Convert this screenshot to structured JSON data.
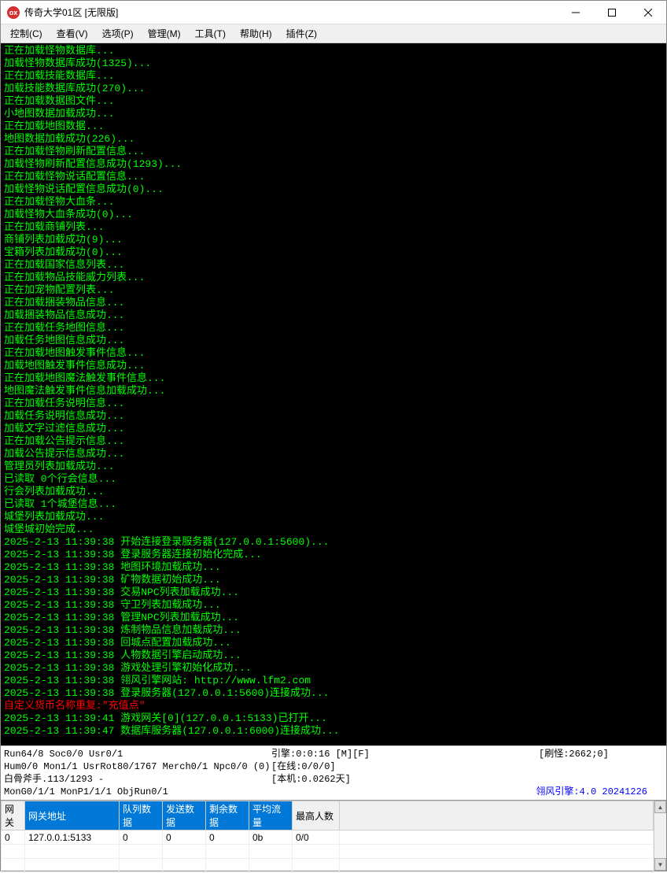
{
  "title": "传奇大学01区 [无限版]",
  "menu": [
    {
      "label": "控制(C)"
    },
    {
      "label": "查看(V)"
    },
    {
      "label": "选项(P)"
    },
    {
      "label": "管理(M)"
    },
    {
      "label": "工具(T)"
    },
    {
      "label": "帮助(H)"
    },
    {
      "label": "插件(Z)"
    }
  ],
  "log": [
    {
      "t": "正在加载怪物数据库..."
    },
    {
      "t": "加载怪物数据库成功(1325)..."
    },
    {
      "t": "正在加载技能数据库..."
    },
    {
      "t": "加载技能数据库成功(270)..."
    },
    {
      "t": "正在加载数据图文件..."
    },
    {
      "t": "小地图数据加载成功..."
    },
    {
      "t": "正在加载地图数据..."
    },
    {
      "t": "地图数据加载成功(226)..."
    },
    {
      "t": "正在加载怪物刷新配置信息..."
    },
    {
      "t": "加载怪物刷新配置信息成功(1293)..."
    },
    {
      "t": "正在加载怪物说话配置信息..."
    },
    {
      "t": "加载怪物说话配置信息成功(0)..."
    },
    {
      "t": "正在加载怪物大血条..."
    },
    {
      "t": "加载怪物大血条成功(0)..."
    },
    {
      "t": "正在加载商铺列表..."
    },
    {
      "t": "商铺列表加载成功(9)..."
    },
    {
      "t": "宝箱列表加载成功(0)..."
    },
    {
      "t": "正在加载国家信息列表..."
    },
    {
      "t": "正在加载物品技能威力列表..."
    },
    {
      "t": "正在加宠物配置列表..."
    },
    {
      "t": "正在加载捆装物品信息..."
    },
    {
      "t": "加载捆装物品信息成功..."
    },
    {
      "t": "正在加载任务地图信息..."
    },
    {
      "t": "加载任务地图信息成功..."
    },
    {
      "t": "正在加载地图触发事件信息..."
    },
    {
      "t": "加载地图触发事件信息成功..."
    },
    {
      "t": "正在加载地图魔法触发事件信息..."
    },
    {
      "t": "地图魔法触发事件信息加载成功..."
    },
    {
      "t": "正在加载任务说明信息..."
    },
    {
      "t": "加载任务说明信息成功..."
    },
    {
      "t": "加载文字过滤信息成功..."
    },
    {
      "t": "正在加载公告提示信息..."
    },
    {
      "t": "加载公告提示信息成功..."
    },
    {
      "t": "管理员列表加载成功..."
    },
    {
      "t": "已读取 0个行会信息..."
    },
    {
      "t": "行会列表加载成功..."
    },
    {
      "t": "已读取 1个城堡信息..."
    },
    {
      "t": "城堡列表加载成功..."
    },
    {
      "t": "城堡城初始完成..."
    },
    {
      "t": "2025-2-13 11:39:38 开始连接登录服务器(127.0.0.1:5600)..."
    },
    {
      "t": "2025-2-13 11:39:38 登录服务器连接初始化完成..."
    },
    {
      "t": "2025-2-13 11:39:38 地图环境加载成功..."
    },
    {
      "t": "2025-2-13 11:39:38 矿物数据初始成功..."
    },
    {
      "t": "2025-2-13 11:39:38 交易NPC列表加载成功..."
    },
    {
      "t": "2025-2-13 11:39:38 守卫列表加载成功..."
    },
    {
      "t": "2025-2-13 11:39:38 管理NPC列表加载成功..."
    },
    {
      "t": "2025-2-13 11:39:38 炼制物品信息加载成功..."
    },
    {
      "t": "2025-2-13 11:39:38 回城点配置加载成功..."
    },
    {
      "t": "2025-2-13 11:39:38 人物数据引擎启动成功..."
    },
    {
      "t": "2025-2-13 11:39:38 游戏处理引擎初始化成功..."
    },
    {
      "t": "2025-2-13 11:39:38 翎风引擎网站: http://www.lfm2.com"
    },
    {
      "t": "2025-2-13 11:39:38 登录服务器(127.0.0.1:5600)连接成功..."
    },
    {
      "t": "自定义货币名称重复:\"充值点\"",
      "c": "red"
    },
    {
      "t": "2025-2-13 11:39:41 游戏网关[0](127.0.0.1:5133)已打开..."
    },
    {
      "t": "2025-2-13 11:39:47 数据库服务器(127.0.0.1:6000)连接成功..."
    }
  ],
  "status": {
    "r1c1": "Run64/8 Soc0/0 Usr0/1",
    "r1c2": "引擎:0:0:16 [M][F]",
    "r1c3": "[刷怪:2662;0]",
    "r2c1": "Hum0/0 Mon1/1 UsrRot80/1767 Merch0/1 Npc0/0 (0)",
    "r2c2": "[在线:0/0/0]",
    "r3c1": "白骨斧手.113/1293 -",
    "r3c2": "[本机:0.0262天]",
    "r4c1": "MonG0/1/1 MonP1/1/1 ObjRun0/1",
    "engine": "翎风引擎:4.0 20241226"
  },
  "grid": {
    "headers": [
      "网关",
      "网关地址",
      "队列数据",
      "发送数据",
      "剩余数据",
      "平均流量",
      "最高人数"
    ],
    "rows": [
      [
        "0",
        "127.0.0.1:5133",
        "0",
        "0",
        "0",
        "0b",
        "0/0"
      ]
    ]
  }
}
